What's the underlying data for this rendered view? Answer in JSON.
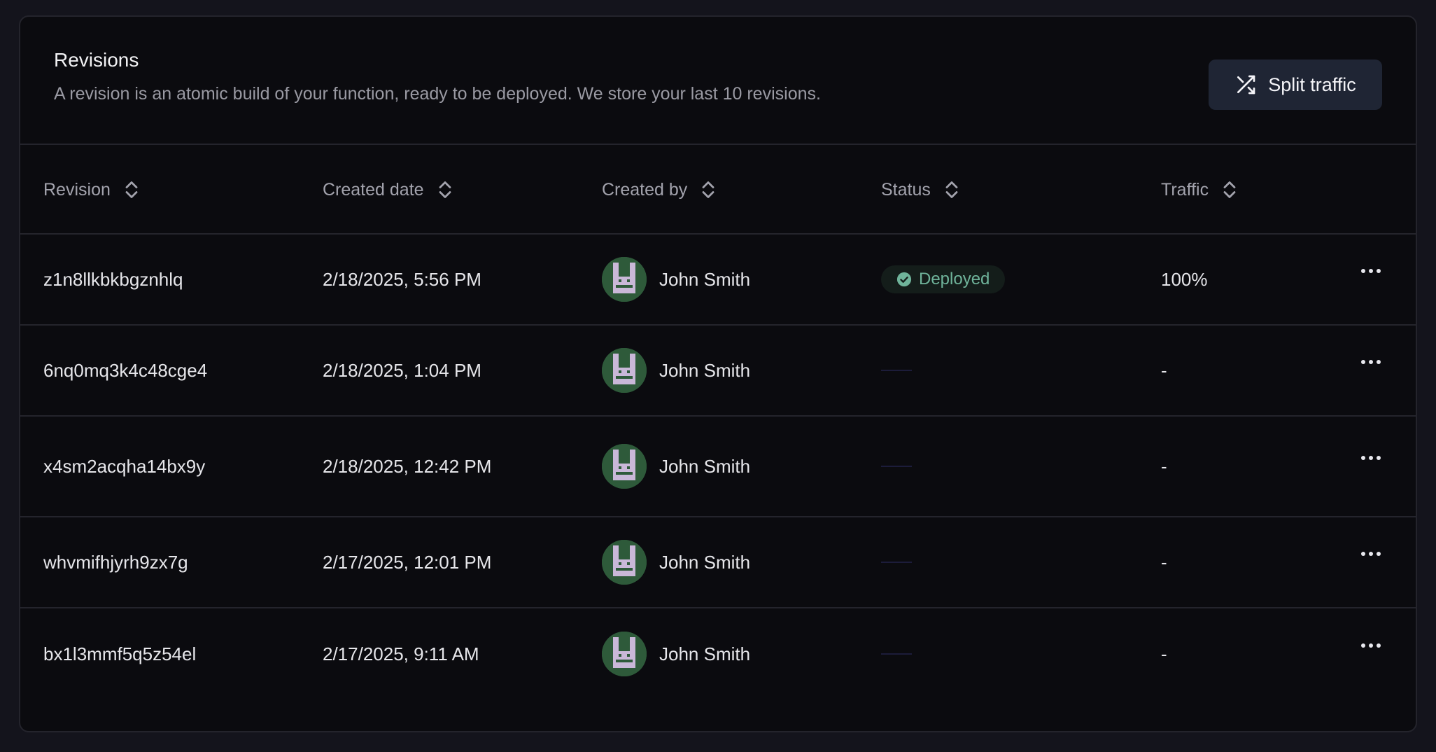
{
  "header": {
    "title": "Revisions",
    "subtitle": "A revision is an atomic build of your function, ready to be deployed. We store your last 10 revisions.",
    "split_button": {
      "label": "Split traffic",
      "icon": "shuffle-icon"
    }
  },
  "columns": [
    {
      "label": "Revision",
      "icon": "sort-icon"
    },
    {
      "label": "Created date",
      "icon": "sort-icon"
    },
    {
      "label": "Created by",
      "icon": "sort-icon"
    },
    {
      "label": "Status",
      "icon": "sort-icon"
    },
    {
      "label": "Traffic",
      "icon": "sort-icon"
    }
  ],
  "rows": [
    {
      "revision": "z1n8llkbkbgznhlq",
      "created_date": "2/18/2025, 5:56 PM",
      "created_by": "John Smith",
      "status": "Deployed",
      "traffic": "100%"
    },
    {
      "revision": "6nq0mq3k4c48cge4",
      "created_date": "2/18/2025, 1:04 PM",
      "created_by": "John Smith",
      "status": "",
      "traffic": "-"
    },
    {
      "revision": "x4sm2acqha14bx9y",
      "created_date": "2/18/2025, 12:42 PM",
      "created_by": "John Smith",
      "status": "",
      "traffic": "-"
    },
    {
      "revision": "whvmifhjyrh9zx7g",
      "created_date": "2/17/2025, 12:01 PM",
      "created_by": "John Smith",
      "status": "",
      "traffic": "-"
    },
    {
      "revision": "bx1l3mmf5q5z54el",
      "created_date": "2/17/2025, 9:11 AM",
      "created_by": "John Smith",
      "status": "",
      "traffic": "-"
    }
  ],
  "colors": {
    "background": "#14141c",
    "card": "#0b0b0f",
    "button": "#1f2534",
    "deployed_text": "#6fb39a",
    "avatar_bg": "#2e5a3a",
    "avatar_fg": "#c9b8d8"
  }
}
